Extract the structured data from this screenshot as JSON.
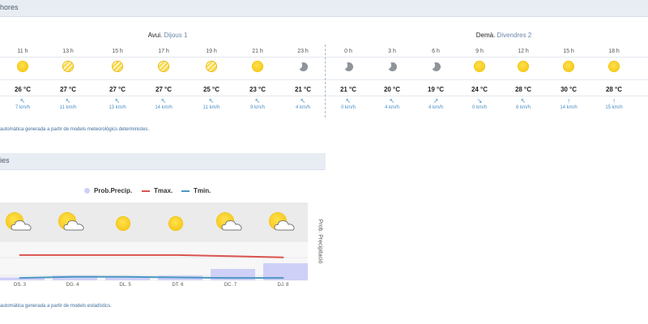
{
  "hourly": {
    "section_title": "hores",
    "days": [
      {
        "label": "Avui.",
        "sub": "Dijous 1"
      },
      {
        "label": "Demà.",
        "sub": "Divendres 2"
      }
    ],
    "columns": [
      {
        "hour": "11 h",
        "icon": "sun-icon",
        "temp": "26 °C",
        "arrow": "↖",
        "wind": "7 km/h"
      },
      {
        "hour": "13 h",
        "icon": "sun-haze-icon",
        "temp": "27 °C",
        "arrow": "↖",
        "wind": "11 km/h"
      },
      {
        "hour": "15 h",
        "icon": "sun-haze-icon",
        "temp": "27 °C",
        "arrow": "↖",
        "wind": "13 km/h"
      },
      {
        "hour": "17 h",
        "icon": "sun-haze-icon",
        "temp": "27 °C",
        "arrow": "↖",
        "wind": "14 km/h"
      },
      {
        "hour": "19 h",
        "icon": "sun-haze-icon",
        "temp": "25 °C",
        "arrow": "↖",
        "wind": "11 km/h"
      },
      {
        "hour": "21 h",
        "icon": "sun-icon",
        "temp": "23 °C",
        "arrow": "↖",
        "wind": "9 km/h"
      },
      {
        "hour": "23 h",
        "icon": "moon-icon",
        "temp": "21 °C",
        "arrow": "↖",
        "wind": "4 km/h"
      },
      {
        "hour": "0 h",
        "icon": "moon-icon",
        "temp": "21 °C",
        "arrow": "↖",
        "wind": "0 km/h"
      },
      {
        "hour": "3 h",
        "icon": "moon-icon",
        "temp": "20 °C",
        "arrow": "↖",
        "wind": "4 km/h"
      },
      {
        "hour": "6 h",
        "icon": "moon-icon",
        "temp": "19 °C",
        "arrow": "↗",
        "wind": "4 km/h"
      },
      {
        "hour": "9 h",
        "icon": "sun-icon",
        "temp": "24 °C",
        "arrow": "↘",
        "wind": "0 km/h"
      },
      {
        "hour": "12 h",
        "icon": "sun-icon",
        "temp": "28 °C",
        "arrow": "↖",
        "wind": "6 km/h"
      },
      {
        "hour": "15 h",
        "icon": "sun-icon",
        "temp": "30 °C",
        "arrow": "↑",
        "wind": "14 km/h"
      },
      {
        "hour": "18 h",
        "icon": "sun-icon",
        "temp": "28 °C",
        "arrow": "↑",
        "wind": "15 km/h"
      }
    ],
    "note": "automàtica generada a partir de models meteorològics deterministes."
  },
  "daily": {
    "section_title": "ies",
    "legend": {
      "precip": "Prob.Precip.",
      "tmax": "Tmax.",
      "tmin": "Tmin."
    },
    "y2label": "Prob. Precipitació",
    "note": "automàtica generada a partir de models estadístics."
  },
  "chart_data": {
    "type": "line",
    "categories": [
      "DS. 3",
      "DG. 4",
      "DL. 5",
      "DT. 6",
      "DC. 7",
      "DJ. 8"
    ],
    "icons": [
      "sun-cloud-icon",
      "sun-cloud-icon",
      "sun-icon",
      "sun-icon",
      "sun-cloud-icon",
      "sun-cloud-icon"
    ],
    "series": [
      {
        "name": "Prob.Precip.",
        "kind": "bar",
        "values": [
          5,
          8,
          5,
          8,
          20,
          30
        ]
      },
      {
        "name": "Tmax.",
        "kind": "line",
        "values": [
          30,
          30,
          30,
          30,
          29.5,
          29
        ]
      },
      {
        "name": "Tmin.",
        "kind": "line",
        "values": [
          20,
          20.5,
          20.5,
          20.2,
          20,
          20
        ]
      }
    ],
    "temp_range": [
      14,
      36
    ],
    "precip_range": [
      0,
      100
    ],
    "grid": true
  },
  "colors": {
    "precip": "#cfd0f7",
    "tmax": "#d9534f",
    "tmin": "#4a97c4",
    "plot_band": "#ebebeb",
    "accent": "#4a90c4"
  }
}
